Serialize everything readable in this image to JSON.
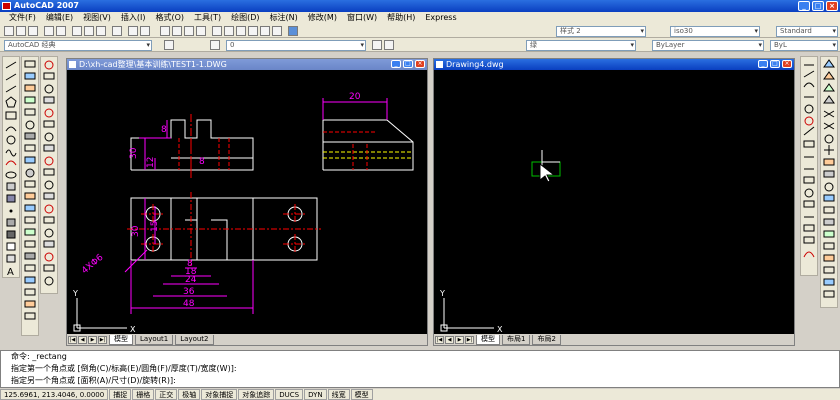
{
  "window": {
    "title": "AutoCAD 2007"
  },
  "menu": [
    "文件(F)",
    "编辑(E)",
    "视图(V)",
    "插入(I)",
    "格式(O)",
    "工具(T)",
    "绘图(D)",
    "标注(N)",
    "修改(M)",
    "窗口(W)",
    "帮助(H)",
    "Express"
  ],
  "toolbar": {
    "workspace": "AutoCAD 经典",
    "layer": "0",
    "text_style": "样式 2",
    "dim_style": "iso30",
    "table_style": "Standard",
    "linetype": "ByLayer",
    "color": "绿",
    "lineweight": "ByL"
  },
  "drawing1": {
    "title": "D:\\xh-cad整理\\基本训练\\TEST1-1.DWG",
    "tabs": [
      "模型",
      "Layout1",
      "Layout2"
    ],
    "dims": {
      "d1": "8",
      "d2": "30",
      "d3": "12",
      "d4": "8",
      "d5": "20",
      "d6": "30",
      "d7": "15",
      "d8": "8",
      "d9": "18",
      "d10": "24",
      "d11": "36",
      "d12": "48",
      "holes": "4XΦ6"
    }
  },
  "drawing2": {
    "title": "Drawing4.dwg",
    "tabs": [
      "模型",
      "布局1",
      "布局2"
    ]
  },
  "ucs": {
    "x": "X",
    "y": "Y"
  },
  "command": {
    "lines": [
      "命令:  _rectang",
      "指定第一个角点或 [倒角(C)/标高(E)/圆角(F)/厚度(T)/宽度(W)]:",
      "指定另一个角点或 [面积(A)/尺寸(D)/旋转(R)]:"
    ]
  },
  "status": {
    "coords": "125.6961, 213.4046, 0.0000",
    "buttons": [
      "捕捉",
      "栅格",
      "正交",
      "极轴",
      "对象捕捉",
      "对象追踪",
      "DUCS",
      "DYN",
      "线宽",
      "模型"
    ]
  },
  "colors": {
    "bg": "#000000",
    "magenta": "#ff00ff",
    "white": "#ffffff",
    "red": "#ff0000",
    "yellow": "#ffff00",
    "green": "#00c000"
  }
}
